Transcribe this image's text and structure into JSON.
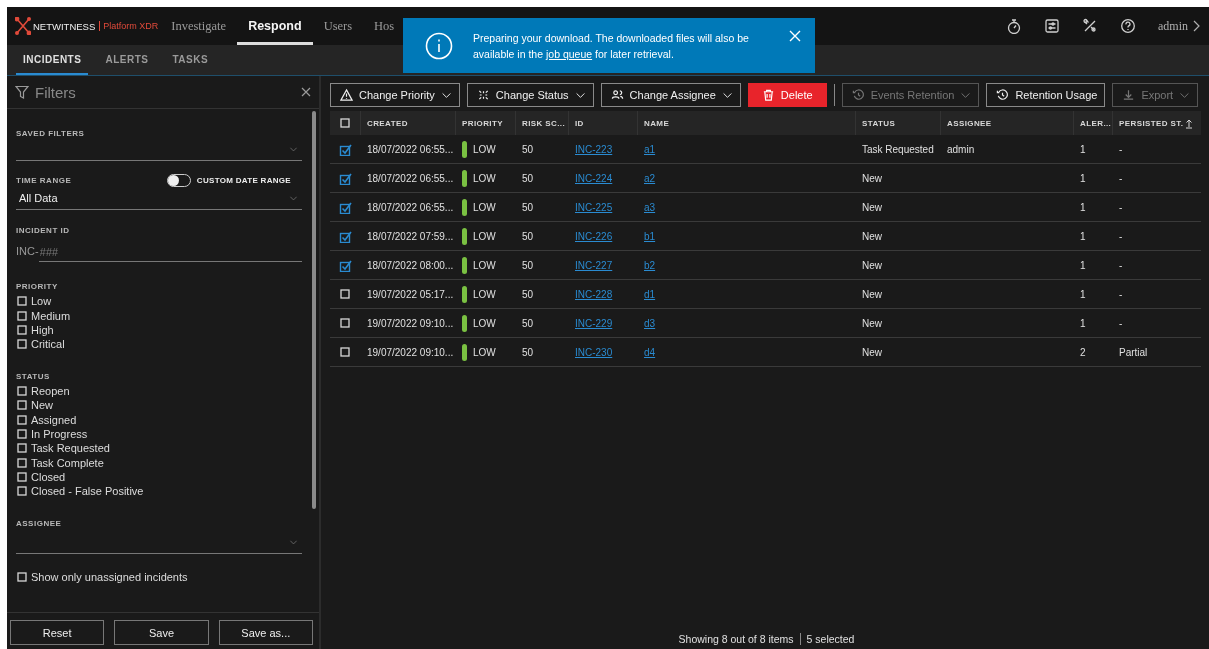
{
  "nav": {
    "brand": "NETWITNESS",
    "product": "Platform XDR",
    "items": [
      {
        "label": "Investigate",
        "selected": false
      },
      {
        "label": "Respond",
        "selected": true
      },
      {
        "label": "Users",
        "selected": false
      },
      {
        "label": "Hos",
        "selected": false
      }
    ],
    "user": "admin"
  },
  "tabs": [
    {
      "label": "INCIDENTS",
      "selected": true
    },
    {
      "label": "ALERTS",
      "selected": false
    },
    {
      "label": "TASKS",
      "selected": false
    }
  ],
  "toast": {
    "text_before": "Preparing your download. The downloaded files will also be available in the",
    "link": "job queue",
    "text_after": "for later retrieval."
  },
  "filters": {
    "title": "Filters",
    "saved_filters_label": "SAVED FILTERS",
    "time_range_label": "TIME RANGE",
    "custom_date_range": {
      "label": "CUSTOM DATE RANGE",
      "on": false
    },
    "time_range_value": "All Data",
    "incident_id_label": "INCIDENT ID",
    "incident_id_prefix": "INC-",
    "incident_id_placeholder": "###",
    "groups": [
      {
        "label": "PRIORITY",
        "options": [
          {
            "label": "Low",
            "checked": false
          },
          {
            "label": "Medium",
            "checked": false
          },
          {
            "label": "High",
            "checked": false
          },
          {
            "label": "Critical",
            "checked": false
          }
        ]
      },
      {
        "label": "STATUS",
        "options": [
          {
            "label": "Reopen",
            "checked": false
          },
          {
            "label": "New",
            "checked": false
          },
          {
            "label": "Assigned",
            "checked": false
          },
          {
            "label": "In Progress",
            "checked": false
          },
          {
            "label": "Task Requested",
            "checked": false
          },
          {
            "label": "Task Complete",
            "checked": false
          },
          {
            "label": "Closed",
            "checked": false
          },
          {
            "label": "Closed - False Positive",
            "checked": false
          }
        ]
      }
    ],
    "assignee_label": "ASSIGNEE",
    "unassigned": {
      "label": "Show only unassigned incidents",
      "checked": false
    },
    "buttons": [
      "Reset",
      "Save",
      "Save as..."
    ]
  },
  "toolbar": [
    {
      "label": "Change Priority",
      "dropdown": true,
      "kind": "normal",
      "disabled": false
    },
    {
      "label": "Change Status",
      "dropdown": true,
      "kind": "normal",
      "disabled": false
    },
    {
      "label": "Change Assignee",
      "dropdown": true,
      "kind": "normal",
      "disabled": false
    },
    {
      "label": "Delete",
      "dropdown": false,
      "kind": "danger",
      "disabled": false
    },
    {
      "label": "Events Retention",
      "dropdown": true,
      "kind": "normal",
      "disabled": true
    },
    {
      "label": "Retention Usage",
      "dropdown": false,
      "kind": "normal",
      "disabled": false
    },
    {
      "label": "Export",
      "dropdown": true,
      "kind": "normal",
      "disabled": true
    }
  ],
  "table": {
    "all_selected": false,
    "columns": [
      "CREATED",
      "PRIORITY",
      "RISK SC...",
      "ID",
      "NAME",
      "STATUS",
      "ASSIGNEE",
      "ALER...",
      "PERSISTED ST."
    ],
    "rows": [
      {
        "selected": true,
        "created": "18/07/2022 06:55...",
        "priority": "LOW",
        "risk_score": "50",
        "id": "INC-223",
        "name": "a1",
        "status": "Task Requested",
        "assignee": "admin",
        "alerts": "1",
        "persisted_status": "-"
      },
      {
        "selected": true,
        "created": "18/07/2022 06:55...",
        "priority": "LOW",
        "risk_score": "50",
        "id": "INC-224",
        "name": "a2",
        "status": "New",
        "alerts": "1",
        "persisted_status": "-"
      },
      {
        "selected": true,
        "created": "18/07/2022 06:55...",
        "priority": "LOW",
        "risk_score": "50",
        "id": "INC-225",
        "name": "a3",
        "status": "New",
        "alerts": "1",
        "persisted_status": "-"
      },
      {
        "selected": true,
        "created": "18/07/2022 07:59...",
        "priority": "LOW",
        "risk_score": "50",
        "id": "INC-226",
        "name": "b1",
        "status": "New",
        "alerts": "1",
        "persisted_status": "-"
      },
      {
        "selected": true,
        "created": "18/07/2022 08:00...",
        "priority": "LOW",
        "risk_score": "50",
        "id": "INC-227",
        "name": "b2",
        "status": "New",
        "alerts": "1",
        "persisted_status": "-"
      },
      {
        "selected": false,
        "created": "19/07/2022 05:17...",
        "priority": "LOW",
        "risk_score": "50",
        "id": "INC-228",
        "name": "d1",
        "status": "New",
        "alerts": "1",
        "persisted_status": "-"
      },
      {
        "selected": false,
        "created": "19/07/2022 09:10...",
        "priority": "LOW",
        "risk_score": "50",
        "id": "INC-229",
        "name": "d3",
        "status": "New",
        "alerts": "1",
        "persisted_status": "-"
      },
      {
        "selected": false,
        "created": "19/07/2022 09:10...",
        "priority": "LOW",
        "risk_score": "50",
        "id": "INC-230",
        "name": "d4",
        "status": "New",
        "alerts": "2",
        "persisted_status": "Partial"
      }
    ]
  },
  "footer": {
    "count": "Showing 8 out of 8 items",
    "selected": "5 selected"
  }
}
